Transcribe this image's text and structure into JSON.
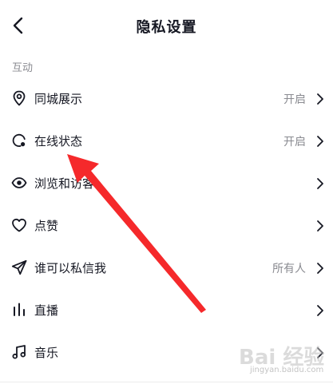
{
  "header": {
    "title": "隐私设置",
    "back_icon": "chevron-left-icon"
  },
  "section": {
    "label": "互动"
  },
  "items": [
    {
      "label": "同城展示",
      "value": "开启",
      "icon": "location-pin-icon"
    },
    {
      "label": "在线状态",
      "value": "开启",
      "icon": "online-status-icon"
    },
    {
      "label": "浏览和访客",
      "value": "",
      "icon": "eye-icon"
    },
    {
      "label": "点赞",
      "value": "",
      "icon": "heart-icon"
    },
    {
      "label": "谁可以私信我",
      "value": "所有人",
      "icon": "send-icon"
    },
    {
      "label": "直播",
      "value": "",
      "icon": "live-bars-icon"
    },
    {
      "label": "音乐",
      "value": "",
      "icon": "music-note-icon"
    }
  ],
  "watermark": {
    "text": "Bai 经验",
    "sub": "jingyan.baidu.com"
  },
  "colors": {
    "text": "#161823",
    "secondary": "#8a8b91",
    "annotation_arrow": "#f5292b"
  }
}
